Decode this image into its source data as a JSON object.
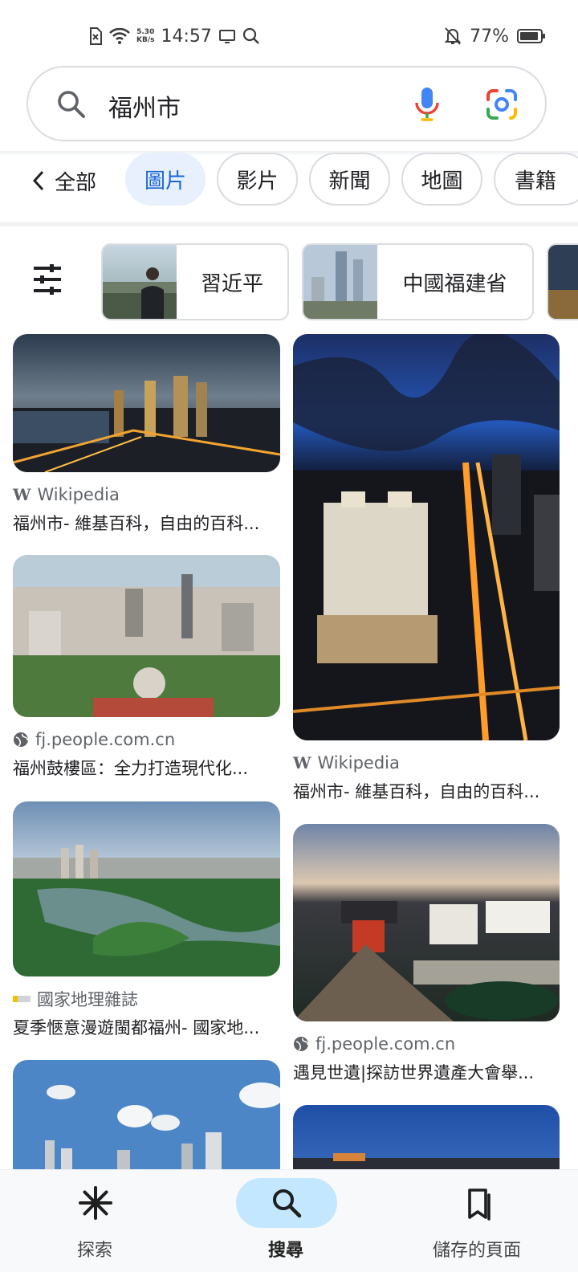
{
  "status_bar": {
    "time": "14:57",
    "net_speed_value": "5.30",
    "net_speed_unit": "KB/s",
    "battery": "77%"
  },
  "search": {
    "query": "福州市"
  },
  "tabs": {
    "all": "全部",
    "items": [
      "圖片",
      "影片",
      "新聞",
      "地圖",
      "書籍"
    ],
    "active": "圖片"
  },
  "suggestions": [
    "習近平",
    "中國福建省"
  ],
  "results": {
    "left": [
      {
        "source": "Wikipedia",
        "title": "福州市- 維基百科，自由的百科..."
      },
      {
        "source": "fj.people.com.cn",
        "title": "福州鼓樓區：全力打造現代化..."
      },
      {
        "source": "國家地理雜誌",
        "title": "夏季愜意漫遊閩都福州- 國家地..."
      }
    ],
    "right": [
      {
        "source": "Wikipedia",
        "title": "福州市- 維基百科，自由的百科..."
      },
      {
        "source": "fj.people.com.cn",
        "title": "遇見世遺|探訪世界遺產大會舉..."
      }
    ]
  },
  "bottom_nav": {
    "discover": "探索",
    "search": "搜尋",
    "saved": "儲存的頁面"
  },
  "colors": {
    "accent": "#1967d2",
    "active_chip_bg": "#e8f0fe",
    "active_nav_bg": "#c2e7ff"
  }
}
